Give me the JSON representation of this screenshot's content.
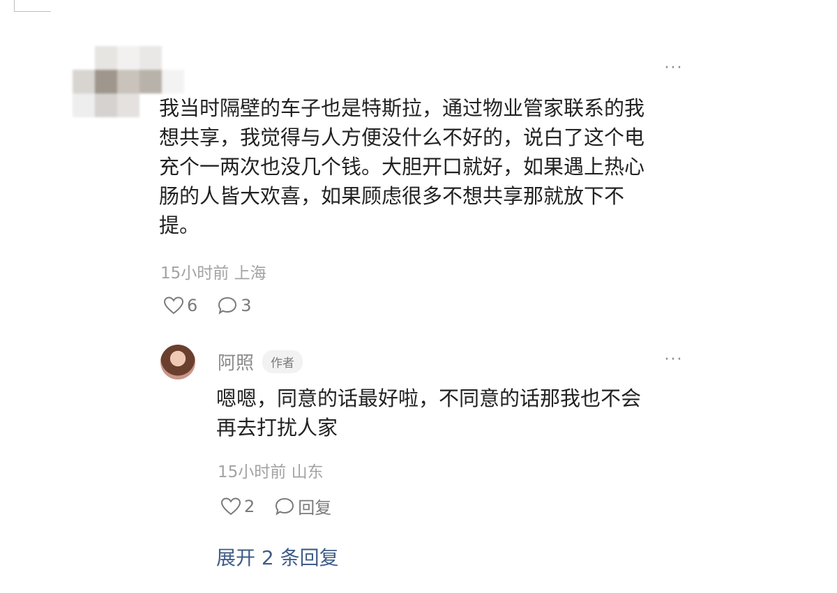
{
  "comment": {
    "more_label": "···",
    "text_lines": [
      "我当时隔壁的车子也是特斯拉，通过物业管家联系的我",
      "想共享，我觉得与人方便没什么不好的，说白了这个电",
      "充个一两次也没几个钱。大胆开口就好，如果遇上热心",
      "肠的人皆大欢喜，如果顾虑很多不想共享那就放下不",
      "提。"
    ],
    "meta": "15小时前 上海",
    "like_count": "6",
    "reply_count": "3",
    "icons": {
      "like": "heart-outline-icon",
      "comment": "speech-bubble-icon",
      "more": "more-dots-icon"
    }
  },
  "reply": {
    "name": "阿照",
    "badge": "作者",
    "more_label": "···",
    "text_lines": [
      "嗯嗯，同意的话最好啦，不同意的话那我也不会",
      "再去打扰人家"
    ],
    "meta": "15小时前 山东",
    "like_count": "2",
    "reply_label": "回复"
  },
  "expand_replies": "展开 2 条回复",
  "colors": {
    "text": "#222222",
    "meta": "#a3a3a3",
    "link": "#3f5d87",
    "icon": "#7a7a7a"
  }
}
